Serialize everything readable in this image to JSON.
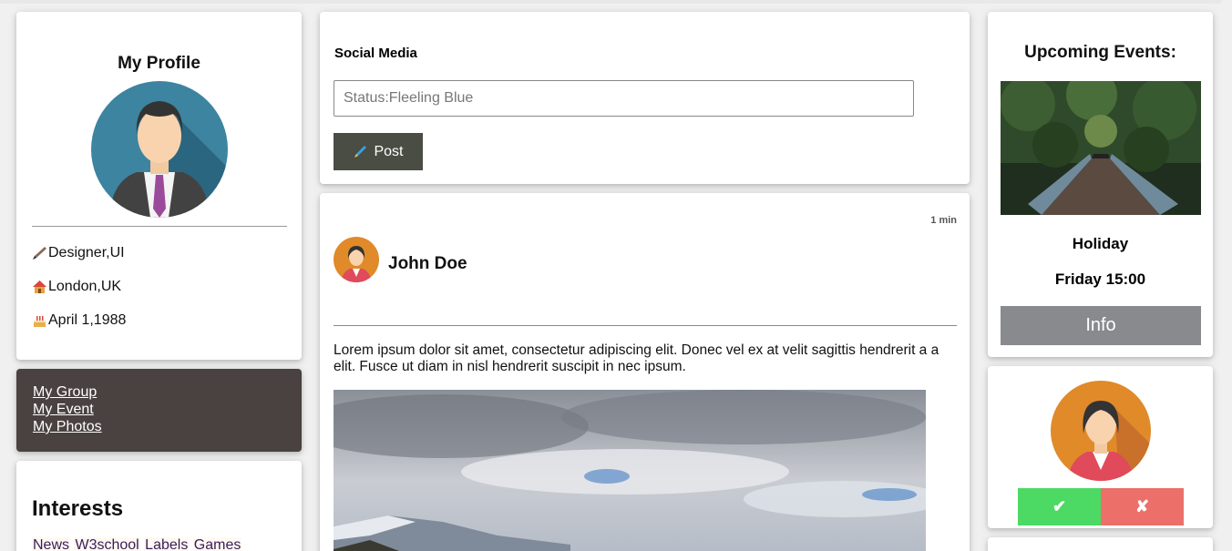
{
  "profile": {
    "title": "My Profile",
    "job": "Designer,UI",
    "location": "London,UK",
    "birthday": "April 1,1988"
  },
  "links": [
    "My Group",
    "My Event",
    "My Photos"
  ],
  "interests": {
    "title": "Interests",
    "tags": [
      "News",
      "W3school",
      "Labels",
      "Games"
    ]
  },
  "compose": {
    "title": "Social Media",
    "status_value": "Status:Fleeling Blue",
    "post_label": "Post"
  },
  "feed": {
    "time": "1 min",
    "author": "John Doe",
    "text": "Lorem ipsum dolor sit amet, consectetur adipiscing elit. Donec vel ex at velit sagittis hendrerit a a elit. Fusce ut diam in nisl hendrerit suscipit in nec ipsum."
  },
  "events": {
    "title": "Upcoming Events:",
    "name": "Holiday",
    "time": "Friday 15:00",
    "info_label": "Info"
  },
  "friend_request": {
    "accept_label": "✔",
    "decline_label": "✘"
  },
  "colors": {
    "links_bg": "#4a4240",
    "post_btn": "#4a4d44",
    "info_btn": "#898a8d",
    "accept": "#4cd964",
    "decline": "#ec6f6a"
  }
}
